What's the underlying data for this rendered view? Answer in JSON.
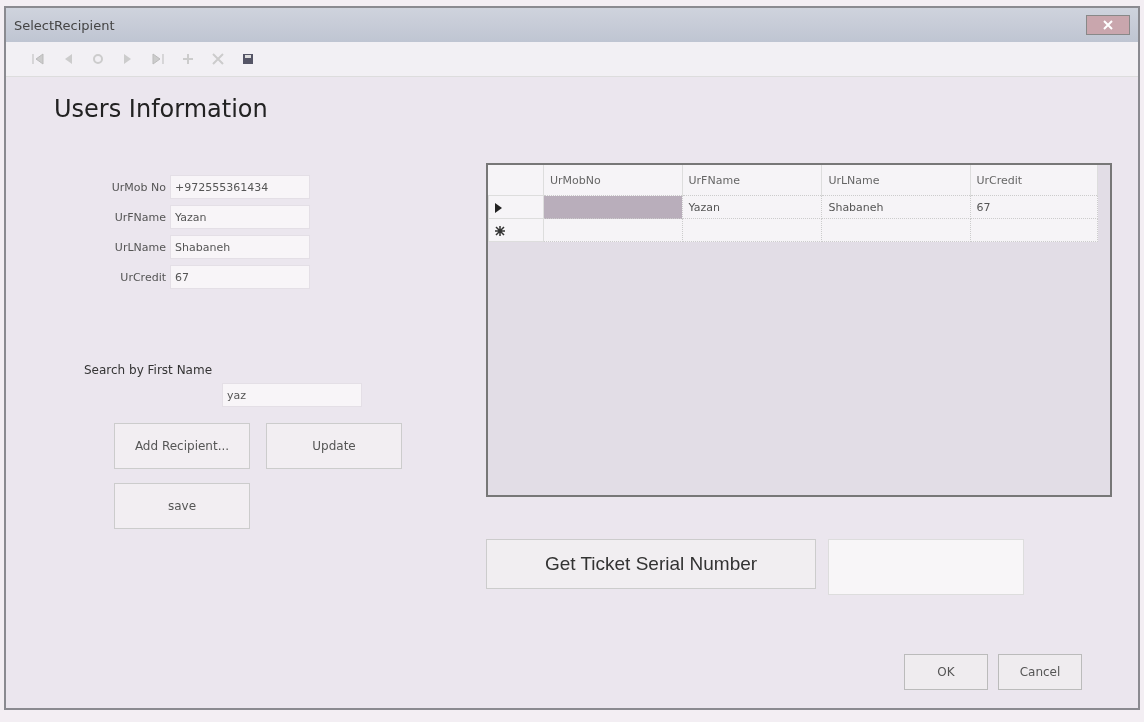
{
  "window": {
    "title": "SelectRecipient"
  },
  "heading": "Users Information",
  "fields": [
    {
      "label": "UrMob No",
      "value": "+972555361434"
    },
    {
      "label": "UrFName",
      "value": "Yazan"
    },
    {
      "label": "UrLName",
      "value": "Shabaneh"
    },
    {
      "label": "UrCredit",
      "value": "67"
    }
  ],
  "search": {
    "label": "Search by First Name",
    "value": "yaz"
  },
  "buttons": [
    "Add Recipient...",
    "Update",
    "save"
  ],
  "table": {
    "columns": [
      "UrMobNo",
      "UrFName",
      "UrLName",
      "UrCredit"
    ],
    "rows": [
      {
        "selected": true,
        "cells": [
          {
            "selected": true
          },
          {
            "text": "Yazan",
            "selected": false
          },
          {
            "text": "Shabaneh",
            "selected": false
          },
          {
            "text": "67",
            "selected": false
          }
        ]
      }
    ],
    "new_row": true
  },
  "ticket": {
    "button": "Get Ticket Serial Number"
  },
  "dialog_buttons": [
    "OK",
    "Cancel"
  ]
}
